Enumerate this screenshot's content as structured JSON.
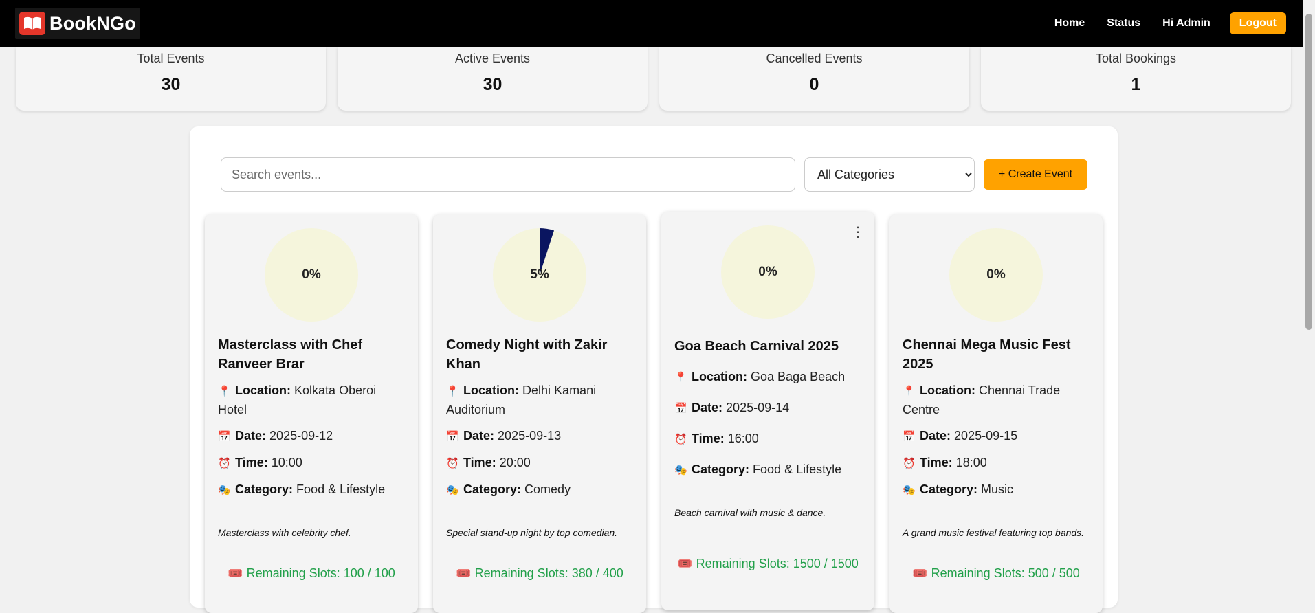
{
  "navbar": {
    "brand": "BookNGo",
    "links": [
      "Home",
      "Status",
      "Hi Admin"
    ],
    "logout_label": "Logout"
  },
  "stats": [
    {
      "label": "Total Events",
      "value": "30"
    },
    {
      "label": "Active Events",
      "value": "30"
    },
    {
      "label": "Cancelled Events",
      "value": "0"
    },
    {
      "label": "Total Bookings",
      "value": "1"
    }
  ],
  "toolbar": {
    "search_placeholder": "Search events...",
    "category_selected": "All Categories",
    "create_label": "+ Create Event"
  },
  "events": [
    {
      "percent": 0,
      "percent_label": "0%",
      "title": "Masterclass with Chef Ranveer Brar",
      "location_label": "Location:",
      "location": "Kolkata Oberoi Hotel",
      "date_label": "Date:",
      "date": "2025-09-12",
      "time_label": "Time:",
      "time": "10:00",
      "category_label": "Category:",
      "category": "Food & Lifestyle",
      "description": "Masterclass with celebrity chef.",
      "slots": "Remaining Slots: 100 / 100"
    },
    {
      "percent": 5,
      "percent_label": "5%",
      "title": "Comedy Night with Zakir Khan",
      "location_label": "Location:",
      "location": "Delhi Kamani Auditorium",
      "date_label": "Date:",
      "date": "2025-09-13",
      "time_label": "Time:",
      "time": "20:00",
      "category_label": "Category:",
      "category": "Comedy",
      "description": "Special stand-up night by top comedian.",
      "slots": "Remaining Slots: 380 / 400"
    },
    {
      "percent": 0,
      "percent_label": "0%",
      "title": "Goa Beach Carnival 2025",
      "location_label": "Location:",
      "location": "Goa Baga Beach",
      "date_label": "Date:",
      "date": "2025-09-14",
      "time_label": "Time:",
      "time": "16:00",
      "category_label": "Category:",
      "category": "Food & Lifestyle",
      "description": "Beach carnival with music & dance.",
      "slots": "Remaining Slots: 1500 / 1500"
    },
    {
      "percent": 0,
      "percent_label": "0%",
      "title": "Chennai Mega Music Fest 2025",
      "location_label": "Location:",
      "location": "Chennai Trade Centre",
      "date_label": "Date:",
      "date": "2025-09-15",
      "time_label": "Time:",
      "time": "18:00",
      "category_label": "Category:",
      "category": "Music",
      "description": "A grand music festival featuring top bands.",
      "slots": "Remaining Slots: 500 / 500"
    }
  ],
  "colors": {
    "navbar": "#000000",
    "accent": "#ffa200",
    "pie_bg": "#f5f5dc",
    "pie_fill": "#0a1560",
    "slots_text": "#22a04a"
  },
  "icons": {
    "location": "pushpin-icon",
    "date": "calendar-icon",
    "time": "alarm-clock-icon",
    "category": "theater-masks-icon",
    "slots": "ticket-icon",
    "menu": "kebab-menu-icon"
  }
}
